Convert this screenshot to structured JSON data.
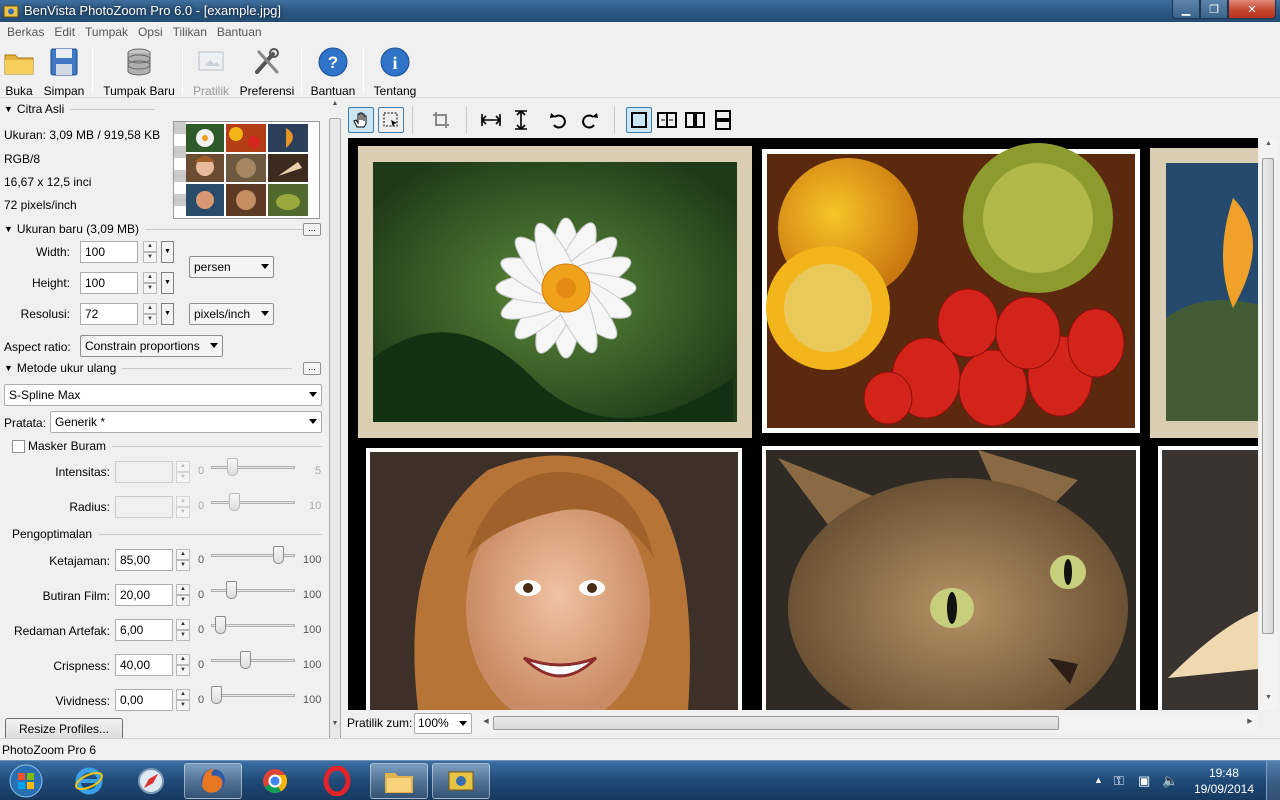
{
  "window": {
    "title": "BenVista PhotoZoom Pro 6.0 - [example.jpg]",
    "min": "▁",
    "max": "❐",
    "close": "✕"
  },
  "menu": [
    "Berkas",
    "Edit",
    "Tumpak",
    "Opsi",
    "Tilikan",
    "Bantuan"
  ],
  "toolbar": {
    "buka": "Buka",
    "simpan": "Simpan",
    "tumpak_baru": "Tumpak Baru",
    "pratilik": "Pratilik",
    "preferensi": "Preferensi",
    "bantuan": "Bantuan",
    "tentang": "Tentang"
  },
  "citra_asli": {
    "title": "Citra Asli",
    "ukuran": "Ukuran: 3,09 MB / 919,58 KB",
    "mode": "RGB/8",
    "dimensi": "16,67 x 12,5 inci",
    "resolusi": "72 pixels/inch"
  },
  "ukuran_baru": {
    "title": "Ukuran baru (3,09 MB)",
    "width_label": "Width:",
    "width": "100",
    "height_label": "Height:",
    "height": "100",
    "resolusi_label": "Resolusi:",
    "resolusi": "72",
    "unit": "persen",
    "res_unit": "pixels/inch",
    "aspect_label": "Aspect ratio:",
    "aspect": "Constrain proportions",
    "more": "..."
  },
  "metode": {
    "title": "Metode ukur ulang",
    "method": "S-Spline Max",
    "pratata_label": "Pratata:",
    "pratata": "Generik *",
    "more": "..."
  },
  "masker": {
    "title": "Masker Buram",
    "intensitas_label": "Intensitas:",
    "intensitas_min": "0",
    "intensitas_max": "5",
    "radius_label": "Radius:",
    "radius_min": "0",
    "radius_max": "10"
  },
  "optimasi": {
    "title": "Pengoptimalan",
    "rows": [
      {
        "label": "Ketajaman:",
        "value": "85,00",
        "min": "0",
        "max": "100",
        "level": 85
      },
      {
        "label": "Butiran Film:",
        "value": "20,00",
        "min": "0",
        "max": "100",
        "level": 20
      },
      {
        "label": "Redaman Artefak:",
        "value": "6,00",
        "min": "0",
        "max": "100",
        "level": 6
      },
      {
        "label": "Crispness:",
        "value": "40,00",
        "min": "0",
        "max": "100",
        "level": 40
      },
      {
        "label": "Vividness:",
        "value": "0,00",
        "min": "0",
        "max": "100",
        "level": 0
      }
    ]
  },
  "resize_profiles": "Resize Profiles...",
  "viewer": {
    "zoom_label": "Pratilik zum:",
    "zoom": "100%"
  },
  "status": "PhotoZoom Pro 6",
  "taskbar": {
    "time": "19:48",
    "date": "19/09/2014"
  },
  "colors": {
    "accent": "#3c7fb1",
    "title_bar": "#2a5680",
    "taskbar": "#1f4a78",
    "canvas": "#000000"
  }
}
